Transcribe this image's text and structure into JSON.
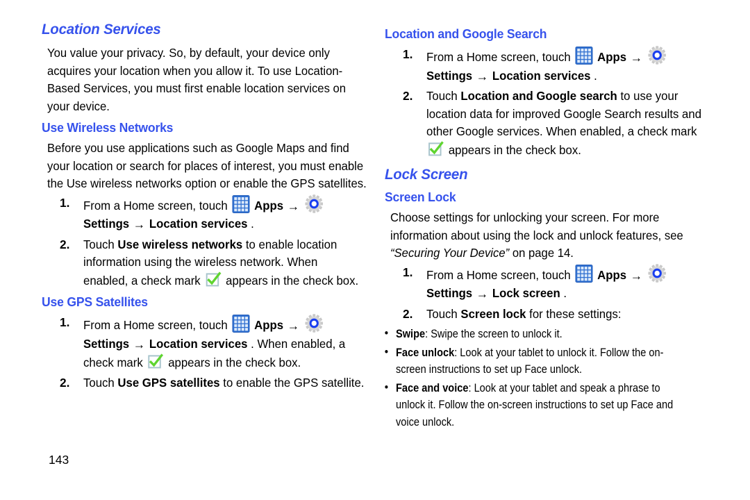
{
  "page": {
    "number": "143"
  },
  "icons": {
    "apps": "apps-grid-icon",
    "settings": "settings-gear-icon",
    "check": "green-check-box-icon",
    "arrow": "→"
  },
  "colors": {
    "heading_blue": "#3652ec",
    "apps_icon_blue": "#2a6fd4",
    "gear_ring_blue": "#1a3ff0",
    "check_green": "#5fd430",
    "check_box_border": "#a8c4cc",
    "text_black": "#000000"
  },
  "left_column": {
    "section_title": "Location Services",
    "intro_paragraph": "You value your privacy. So, by default, your device only acquires your location when you allow it. To use Location-Based Services, you must first enable location services on your device.",
    "subsections": [
      {
        "title": "Use Wireless Networks",
        "paragraph": "Before you use applications such as Google Maps and find your location or search for places of interest, you must enable the Use wireless networks option or enable the GPS satellites.",
        "steps": [
          {
            "number": "1.",
            "parts": [
              {
                "type": "text",
                "value": "From a Home screen, touch "
              },
              {
                "type": "icon",
                "value": "apps"
              },
              {
                "type": "bold",
                "value": "Apps"
              },
              {
                "type": "arrow",
                "value": "→"
              },
              {
                "type": "icon",
                "value": "settings"
              },
              {
                "type": "bold",
                "value": "Settings"
              },
              {
                "type": "arrow",
                "value": "→"
              },
              {
                "type": "bold",
                "value": "Location services"
              },
              {
                "type": "text",
                "value": "."
              }
            ]
          },
          {
            "number": "2.",
            "parts": [
              {
                "type": "text",
                "value": "Touch "
              },
              {
                "type": "bold",
                "value": "Use wireless networks"
              },
              {
                "type": "text",
                "value": " to enable location information using the wireless network. When enabled, a check mark "
              },
              {
                "type": "icon",
                "value": "check"
              },
              {
                "type": "text",
                "value": " appears in the check box."
              }
            ]
          }
        ]
      },
      {
        "title": "Use GPS Satellites",
        "paragraph": "",
        "steps": [
          {
            "number": "1.",
            "parts": [
              {
                "type": "text",
                "value": "From a Home screen, touch "
              },
              {
                "type": "icon",
                "value": "apps"
              },
              {
                "type": "bold",
                "value": "Apps"
              },
              {
                "type": "arrow",
                "value": "→"
              },
              {
                "type": "icon",
                "value": "settings"
              },
              {
                "type": "bold",
                "value": "Settings"
              },
              {
                "type": "arrow",
                "value": "→"
              },
              {
                "type": "bold",
                "value": "Location services"
              },
              {
                "type": "text",
                "value": ". When enabled, a check mark "
              },
              {
                "type": "icon",
                "value": "check"
              },
              {
                "type": "text",
                "value": " appears in the check box."
              }
            ]
          },
          {
            "number": "2.",
            "parts": [
              {
                "type": "text",
                "value": "Touch "
              },
              {
                "type": "bold",
                "value": "Use GPS satellites"
              },
              {
                "type": "text",
                "value": " to enable the GPS satellite."
              }
            ]
          }
        ]
      }
    ]
  },
  "right_column": {
    "first_subsection_title": "Location and Google Search",
    "first_steps": [
      {
        "number": "1.",
        "parts": [
          {
            "type": "text",
            "value": "From a Home screen, touch "
          },
          {
            "type": "icon",
            "value": "apps"
          },
          {
            "type": "bold",
            "value": "Apps"
          },
          {
            "type": "arrow",
            "value": "→"
          },
          {
            "type": "icon",
            "value": "settings"
          },
          {
            "type": "bold",
            "value": "Settings"
          },
          {
            "type": "arrow",
            "value": "→"
          },
          {
            "type": "bold",
            "value": "Location services"
          },
          {
            "type": "text",
            "value": "."
          }
        ]
      },
      {
        "number": "2.",
        "parts": [
          {
            "type": "text",
            "value": "Touch "
          },
          {
            "type": "bold",
            "value": "Location and Google search"
          },
          {
            "type": "text",
            "value": " to use your location data for improved Google Search results and other Google services. When enabled, a check mark "
          },
          {
            "type": "icon",
            "value": "check"
          },
          {
            "type": "text",
            "value": " appears in the check box."
          }
        ]
      }
    ],
    "section_title": "Lock Screen",
    "subsection_title": "Screen Lock",
    "paragraph_plain": "Choose settings for unlocking your screen. For more information about using the lock and unlock features, see ",
    "paragraph_italic": "“Securing Your Device”",
    "paragraph_tail": " on page 14.",
    "second_steps": [
      {
        "number": "1.",
        "parts": [
          {
            "type": "text",
            "value": "From a Home screen, touch "
          },
          {
            "type": "icon",
            "value": "apps"
          },
          {
            "type": "bold",
            "value": "Apps"
          },
          {
            "type": "arrow",
            "value": "→"
          },
          {
            "type": "icon",
            "value": "settings"
          },
          {
            "type": "bold",
            "value": "Settings"
          },
          {
            "type": "arrow",
            "value": "→"
          },
          {
            "type": "bold",
            "value": "Lock screen"
          },
          {
            "type": "text",
            "value": "."
          }
        ]
      },
      {
        "number": "2.",
        "parts": [
          {
            "type": "text",
            "value": "Touch "
          },
          {
            "type": "bold",
            "value": "Screen lock"
          },
          {
            "type": "text",
            "value": " for these settings:"
          }
        ]
      }
    ],
    "bullets": [
      {
        "label": "Swipe",
        "text": ": Swipe the screen to unlock it."
      },
      {
        "label": "Face unlock",
        "text": ": Look at your tablet to unlock it. Follow the on-screen instructions to set up Face unlock."
      },
      {
        "label": "Face and voice",
        "text": ": Look at your tablet and speak a phrase to unlock it. Follow the on-screen instructions to set up Face and voice unlock."
      }
    ]
  }
}
